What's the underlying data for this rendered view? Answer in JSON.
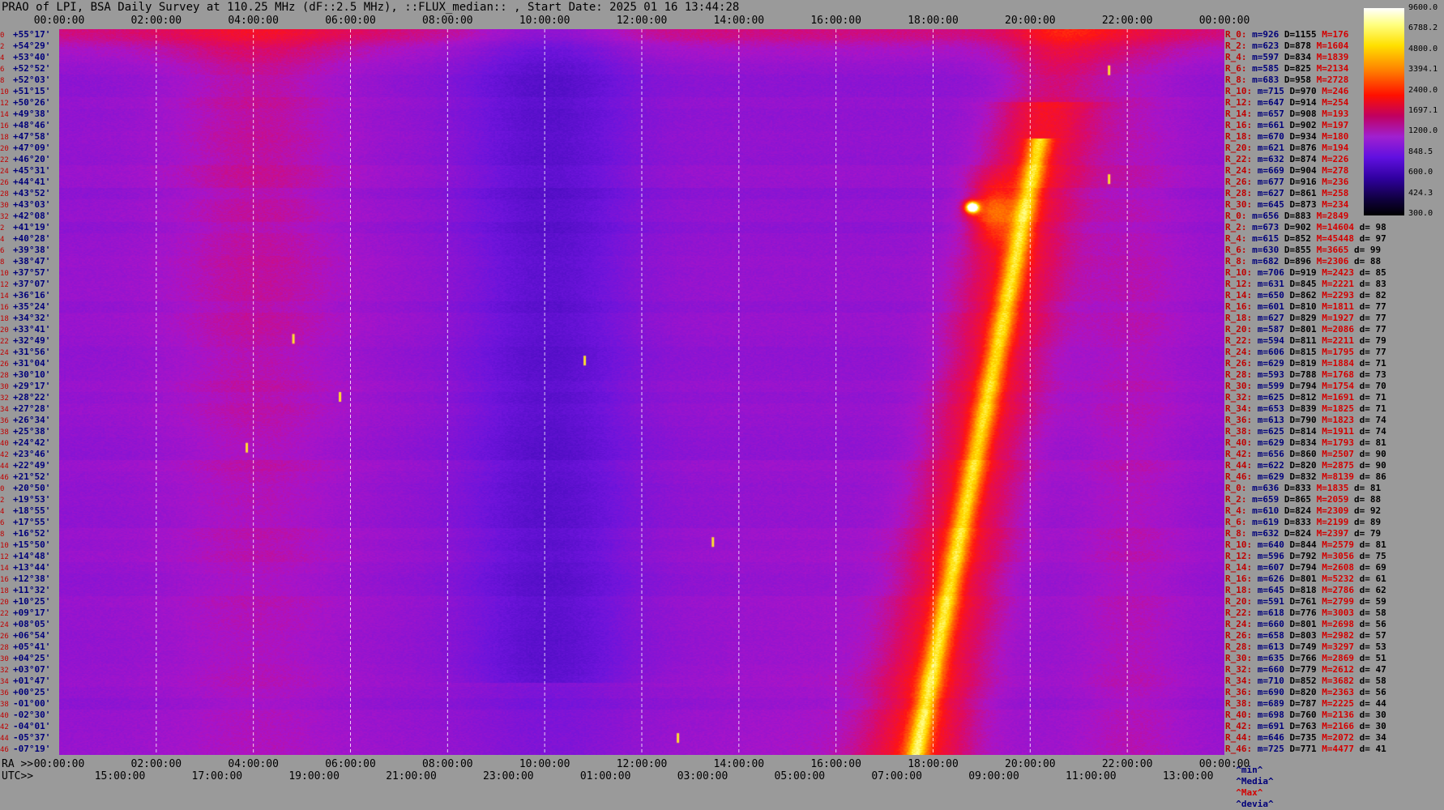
{
  "title": "PRAO of LPI, BSA Daily Survey at 110.25 MHz (dF::2.5 MHz), ::FLUX_median:: , Start Date: 2025 01 16 13:44:28",
  "axes": {
    "ra_prefix": "RA >>",
    "utc_prefix": "UTC>>",
    "top_ticks": [
      "00:00:00",
      "02:00:00",
      "04:00:00",
      "06:00:00",
      "08:00:00",
      "10:00:00",
      "12:00:00",
      "14:00:00",
      "16:00:00",
      "18:00:00",
      "20:00:00",
      "22:00:00",
      "00:00:00"
    ],
    "ra_ticks": [
      "00:00:00",
      "02:00:00",
      "04:00:00",
      "06:00:00",
      "08:00:00",
      "10:00:00",
      "12:00:00",
      "14:00:00",
      "16:00:00",
      "18:00:00",
      "20:00:00",
      "22:00:00",
      "00:00:00"
    ],
    "utc_ticks": [
      "15:00:00",
      "17:00:00",
      "19:00:00",
      "21:00:00",
      "23:00:00",
      "01:00:00",
      "03:00:00",
      "05:00:00",
      "07:00:00",
      "09:00:00",
      "11:00:00",
      "13:00:00"
    ]
  },
  "colorbar": {
    "labels": [
      "9600.0",
      "6788.2",
      "4800.0",
      "3394.1",
      "2400.0",
      "1697.1",
      "1200.0",
      "848.5",
      "600.0",
      "424.3",
      "300.0"
    ],
    "colors": {
      "max": "#ffffff",
      "high": "#ffe000",
      "mid": "#ff1000",
      "low": "#a020d0",
      "min": "#000000"
    }
  },
  "rows": [
    {
      "i": "0",
      "dec": "+55°17'"
    },
    {
      "i": "2",
      "dec": "+54°29'"
    },
    {
      "i": "4",
      "dec": "+53°40'"
    },
    {
      "i": "6",
      "dec": "+52°52'"
    },
    {
      "i": "8",
      "dec": "+52°03'"
    },
    {
      "i": "10",
      "dec": "+51°15'"
    },
    {
      "i": "12",
      "dec": "+50°26'"
    },
    {
      "i": "14",
      "dec": "+49°38'"
    },
    {
      "i": "16",
      "dec": "+48°46'"
    },
    {
      "i": "18",
      "dec": "+47°58'"
    },
    {
      "i": "20",
      "dec": "+47°09'"
    },
    {
      "i": "22",
      "dec": "+46°20'"
    },
    {
      "i": "24",
      "dec": "+45°31'"
    },
    {
      "i": "26",
      "dec": "+44°41'"
    },
    {
      "i": "28",
      "dec": "+43°52'"
    },
    {
      "i": "30",
      "dec": "+43°03'"
    },
    {
      "i": "32",
      "dec": "+42°08'"
    },
    {
      "i": "2",
      "dec": "+41°19'"
    },
    {
      "i": "4",
      "dec": "+40°28'"
    },
    {
      "i": "6",
      "dec": "+39°38'"
    },
    {
      "i": "8",
      "dec": "+38°47'"
    },
    {
      "i": "10",
      "dec": "+37°57'"
    },
    {
      "i": "12",
      "dec": "+37°07'"
    },
    {
      "i": "14",
      "dec": "+36°16'"
    },
    {
      "i": "16",
      "dec": "+35°24'"
    },
    {
      "i": "18",
      "dec": "+34°32'"
    },
    {
      "i": "20",
      "dec": "+33°41'"
    },
    {
      "i": "22",
      "dec": "+32°49'"
    },
    {
      "i": "24",
      "dec": "+31°56'"
    },
    {
      "i": "26",
      "dec": "+31°04'"
    },
    {
      "i": "28",
      "dec": "+30°10'"
    },
    {
      "i": "30",
      "dec": "+29°17'"
    },
    {
      "i": "32",
      "dec": "+28°22'"
    },
    {
      "i": "34",
      "dec": "+27°28'"
    },
    {
      "i": "36",
      "dec": "+26°34'"
    },
    {
      "i": "38",
      "dec": "+25°38'"
    },
    {
      "i": "40",
      "dec": "+24°42'"
    },
    {
      "i": "42",
      "dec": "+23°46'"
    },
    {
      "i": "44",
      "dec": "+22°49'"
    },
    {
      "i": "46",
      "dec": "+21°52'"
    },
    {
      "i": "0",
      "dec": "+20°50'"
    },
    {
      "i": "2",
      "dec": "+19°53'"
    },
    {
      "i": "4",
      "dec": "+18°55'"
    },
    {
      "i": "6",
      "dec": "+17°55'"
    },
    {
      "i": "8",
      "dec": "+16°52'"
    },
    {
      "i": "10",
      "dec": "+15°50'"
    },
    {
      "i": "12",
      "dec": "+14°48'"
    },
    {
      "i": "14",
      "dec": "+13°44'"
    },
    {
      "i": "16",
      "dec": "+12°38'"
    },
    {
      "i": "18",
      "dec": "+11°32'"
    },
    {
      "i": "20",
      "dec": "+10°25'"
    },
    {
      "i": "22",
      "dec": "+09°17'"
    },
    {
      "i": "24",
      "dec": "+08°05'"
    },
    {
      "i": "26",
      "dec": "+06°54'"
    },
    {
      "i": "28",
      "dec": "+05°41'"
    },
    {
      "i": "30",
      "dec": "+04°25'"
    },
    {
      "i": "32",
      "dec": "+03°07'"
    },
    {
      "i": "34",
      "dec": "+01°47'"
    },
    {
      "i": "36",
      "dec": "+00°25'"
    },
    {
      "i": "38",
      "dec": "-01°00'"
    },
    {
      "i": "40",
      "dec": "-02°30'"
    },
    {
      "i": "42",
      "dec": "-04°01'"
    },
    {
      "i": "44",
      "dec": "-05°37'"
    },
    {
      "i": "46",
      "dec": "-07°19'"
    }
  ],
  "stats": [
    {
      "r": "R_0:",
      "m": "m=926",
      "d": "D=1155",
      "x": "M=176",
      "dev": ""
    },
    {
      "r": "R_2:",
      "m": "m=623",
      "d": "D=878",
      "x": "M=1604",
      "dev": ""
    },
    {
      "r": "R_4:",
      "m": "m=597",
      "d": "D=834",
      "x": "M=1839",
      "dev": ""
    },
    {
      "r": "R_6:",
      "m": "m=585",
      "d": "D=825",
      "x": "M=2134",
      "dev": ""
    },
    {
      "r": "R_8:",
      "m": "m=683",
      "d": "D=958",
      "x": "M=2728",
      "dev": ""
    },
    {
      "r": "R_10:",
      "m": "m=715",
      "d": "D=970",
      "x": "M=246",
      "dev": ""
    },
    {
      "r": "R_12:",
      "m": "m=647",
      "d": "D=914",
      "x": "M=254",
      "dev": ""
    },
    {
      "r": "R_14:",
      "m": "m=657",
      "d": "D=908",
      "x": "M=193",
      "dev": ""
    },
    {
      "r": "R_16:",
      "m": "m=661",
      "d": "D=902",
      "x": "M=197",
      "dev": ""
    },
    {
      "r": "R_18:",
      "m": "m=670",
      "d": "D=934",
      "x": "M=180",
      "dev": ""
    },
    {
      "r": "R_20:",
      "m": "m=621",
      "d": "D=876",
      "x": "M=194",
      "dev": ""
    },
    {
      "r": "R_22:",
      "m": "m=632",
      "d": "D=874",
      "x": "M=226",
      "dev": ""
    },
    {
      "r": "R_24:",
      "m": "m=669",
      "d": "D=904",
      "x": "M=278",
      "dev": ""
    },
    {
      "r": "R_26:",
      "m": "m=677",
      "d": "D=916",
      "x": "M=236",
      "dev": ""
    },
    {
      "r": "R_28:",
      "m": "m=627",
      "d": "D=861",
      "x": "M=258",
      "dev": ""
    },
    {
      "r": "R_30:",
      "m": "m=645",
      "d": "D=873",
      "x": "M=234",
      "dev": ""
    },
    {
      "r": "R_0:",
      "m": "m=656",
      "d": "D=883",
      "x": "M=2849",
      "dev": ""
    },
    {
      "r": "R_2:",
      "m": "m=673",
      "d": "D=902",
      "x": "M=14604",
      "dev": "d= 98"
    },
    {
      "r": "R_4:",
      "m": "m=615",
      "d": "D=852",
      "x": "M=45448",
      "dev": "d= 97"
    },
    {
      "r": "R_6:",
      "m": "m=630",
      "d": "D=855",
      "x": "M=3665",
      "dev": "d= 99"
    },
    {
      "r": "R_8:",
      "m": "m=682",
      "d": "D=896",
      "x": "M=2306",
      "dev": "d= 88"
    },
    {
      "r": "R_10:",
      "m": "m=706",
      "d": "D=919",
      "x": "M=2423",
      "dev": "d= 85"
    },
    {
      "r": "R_12:",
      "m": "m=631",
      "d": "D=845",
      "x": "M=2221",
      "dev": "d= 83"
    },
    {
      "r": "R_14:",
      "m": "m=650",
      "d": "D=862",
      "x": "M=2293",
      "dev": "d= 82"
    },
    {
      "r": "R_16:",
      "m": "m=601",
      "d": "D=810",
      "x": "M=1811",
      "dev": "d= 77"
    },
    {
      "r": "R_18:",
      "m": "m=627",
      "d": "D=829",
      "x": "M=1927",
      "dev": "d= 77"
    },
    {
      "r": "R_20:",
      "m": "m=587",
      "d": "D=801",
      "x": "M=2086",
      "dev": "d= 77"
    },
    {
      "r": "R_22:",
      "m": "m=594",
      "d": "D=811",
      "x": "M=2211",
      "dev": "d= 79"
    },
    {
      "r": "R_24:",
      "m": "m=606",
      "d": "D=815",
      "x": "M=1795",
      "dev": "d= 77"
    },
    {
      "r": "R_26:",
      "m": "m=629",
      "d": "D=819",
      "x": "M=1884",
      "dev": "d= 71"
    },
    {
      "r": "R_28:",
      "m": "m=593",
      "d": "D=788",
      "x": "M=1768",
      "dev": "d= 73"
    },
    {
      "r": "R_30:",
      "m": "m=599",
      "d": "D=794",
      "x": "M=1754",
      "dev": "d= 70"
    },
    {
      "r": "R_32:",
      "m": "m=625",
      "d": "D=812",
      "x": "M=1691",
      "dev": "d= 71"
    },
    {
      "r": "R_34:",
      "m": "m=653",
      "d": "D=839",
      "x": "M=1825",
      "dev": "d= 71"
    },
    {
      "r": "R_36:",
      "m": "m=613",
      "d": "D=790",
      "x": "M=1823",
      "dev": "d= 74"
    },
    {
      "r": "R_38:",
      "m": "m=625",
      "d": "D=814",
      "x": "M=1911",
      "dev": "d= 74"
    },
    {
      "r": "R_40:",
      "m": "m=629",
      "d": "D=834",
      "x": "M=1793",
      "dev": "d= 81"
    },
    {
      "r": "R_42:",
      "m": "m=656",
      "d": "D=860",
      "x": "M=2507",
      "dev": "d= 90"
    },
    {
      "r": "R_44:",
      "m": "m=622",
      "d": "D=820",
      "x": "M=2875",
      "dev": "d= 90"
    },
    {
      "r": "R_46:",
      "m": "m=629",
      "d": "D=832",
      "x": "M=8139",
      "dev": "d= 86"
    },
    {
      "r": "R_0:",
      "m": "m=636",
      "d": "D=833",
      "x": "M=1835",
      "dev": "d= 81"
    },
    {
      "r": "R_2:",
      "m": "m=659",
      "d": "D=865",
      "x": "M=2059",
      "dev": "d= 88"
    },
    {
      "r": "R_4:",
      "m": "m=610",
      "d": "D=824",
      "x": "M=2309",
      "dev": "d= 92"
    },
    {
      "r": "R_6:",
      "m": "m=619",
      "d": "D=833",
      "x": "M=2199",
      "dev": "d= 89"
    },
    {
      "r": "R_8:",
      "m": "m=632",
      "d": "D=824",
      "x": "M=2397",
      "dev": "d= 79"
    },
    {
      "r": "R_10:",
      "m": "m=640",
      "d": "D=844",
      "x": "M=2579",
      "dev": "d= 81"
    },
    {
      "r": "R_12:",
      "m": "m=596",
      "d": "D=792",
      "x": "M=3056",
      "dev": "d= 75"
    },
    {
      "r": "R_14:",
      "m": "m=607",
      "d": "D=794",
      "x": "M=2608",
      "dev": "d= 69"
    },
    {
      "r": "R_16:",
      "m": "m=626",
      "d": "D=801",
      "x": "M=5232",
      "dev": "d= 61"
    },
    {
      "r": "R_18:",
      "m": "m=645",
      "d": "D=818",
      "x": "M=2786",
      "dev": "d= 62"
    },
    {
      "r": "R_20:",
      "m": "m=591",
      "d": "D=761",
      "x": "M=2799",
      "dev": "d= 59"
    },
    {
      "r": "R_22:",
      "m": "m=618",
      "d": "D=776",
      "x": "M=3003",
      "dev": "d= 58"
    },
    {
      "r": "R_24:",
      "m": "m=660",
      "d": "D=801",
      "x": "M=2698",
      "dev": "d= 56"
    },
    {
      "r": "R_26:",
      "m": "m=658",
      "d": "D=803",
      "x": "M=2982",
      "dev": "d= 57"
    },
    {
      "r": "R_28:",
      "m": "m=613",
      "d": "D=749",
      "x": "M=3297",
      "dev": "d= 53"
    },
    {
      "r": "R_30:",
      "m": "m=635",
      "d": "D=766",
      "x": "M=2869",
      "dev": "d= 51"
    },
    {
      "r": "R_32:",
      "m": "m=660",
      "d": "D=779",
      "x": "M=2612",
      "dev": "d= 47"
    },
    {
      "r": "R_34:",
      "m": "m=710",
      "d": "D=852",
      "x": "M=3682",
      "dev": "d= 58"
    },
    {
      "r": "R_36:",
      "m": "m=690",
      "d": "D=820",
      "x": "M=2363",
      "dev": "d= 56"
    },
    {
      "r": "R_38:",
      "m": "m=689",
      "d": "D=787",
      "x": "M=2225",
      "dev": "d= 44"
    },
    {
      "r": "R_40:",
      "m": "m=698",
      "d": "D=760",
      "x": "M=2136",
      "dev": "d= 30"
    },
    {
      "r": "R_42:",
      "m": "m=691",
      "d": "D=763",
      "x": "M=2166",
      "dev": "d= 30"
    },
    {
      "r": "R_44:",
      "m": "m=646",
      "d": "D=735",
      "x": "M=2072",
      "dev": "d= 34"
    },
    {
      "r": "R_46:",
      "m": "m=725",
      "d": "D=771",
      "x": "M=4477",
      "dev": "d= 41"
    }
  ],
  "stats_footer": {
    "min": "^min^",
    "median": "^Media^",
    "max": "^Max^",
    "dev": "^devia^"
  },
  "chart_data": {
    "type": "heatmap",
    "title": "PRAO of LPI, BSA Daily Survey at 110.25 MHz (dF::2.5 MHz), ::FLUX_median:: , Start Date: 2025 01 16 13:44:28",
    "x_range_hours": [
      0,
      24
    ],
    "colorscale_range": [
      300.0,
      9600.0
    ],
    "colorscale_log": true,
    "grid": true,
    "features": [
      {
        "desc": "galactic plane bright band",
        "ra_hours": [
          19.5,
          21.0
        ],
        "dec_range": [
          "-07°19'",
          "+46°20'"
        ]
      },
      {
        "desc": "strong source",
        "ra_hours": 20.0,
        "dec": "+40°28'"
      },
      {
        "desc": "cold region",
        "ra_hours": [
          8.0,
          12.5
        ],
        "dec_range": [
          "+10°25'",
          "+53°40'"
        ]
      }
    ]
  }
}
